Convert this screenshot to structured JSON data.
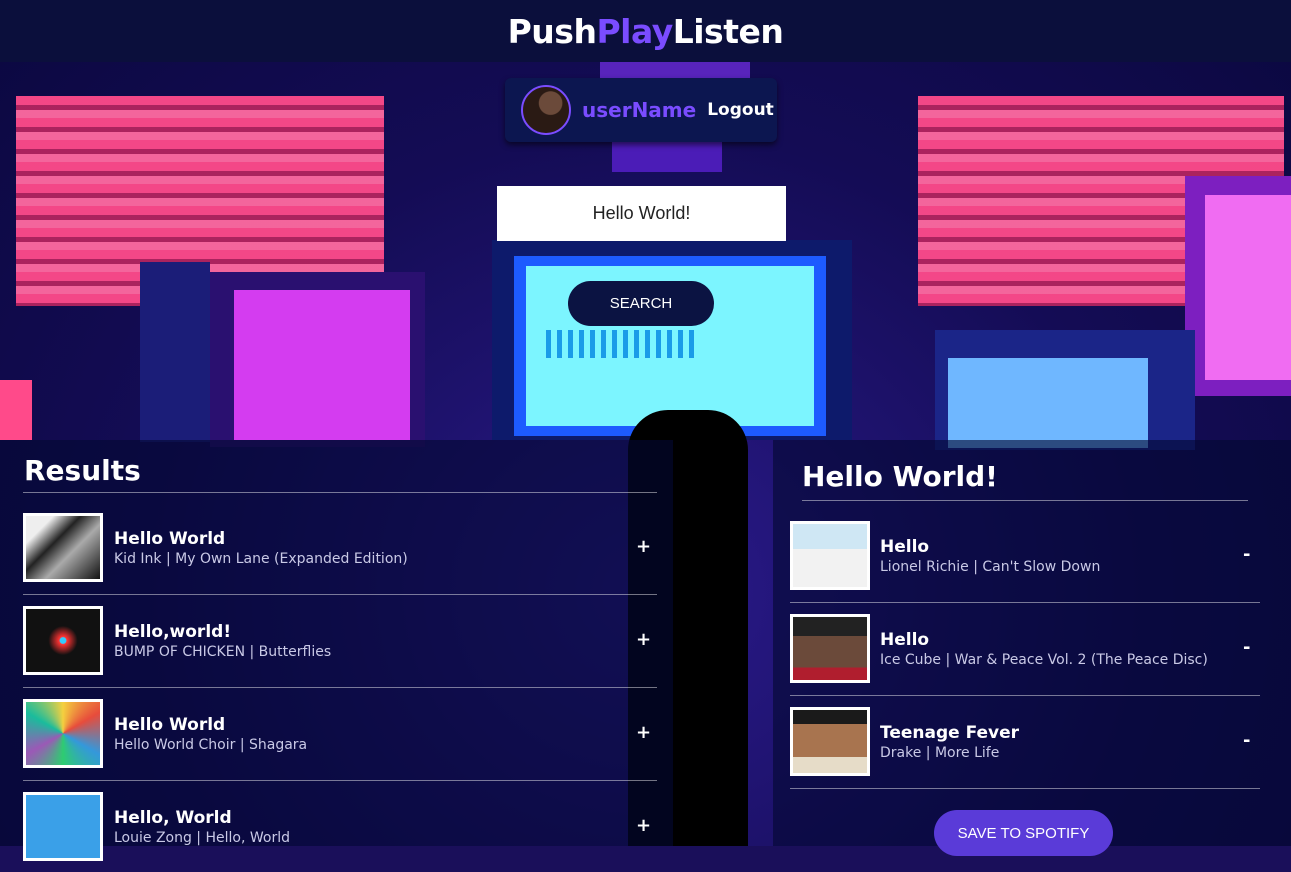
{
  "header": {
    "logo_part1": "Push",
    "logo_part2": "Play",
    "logo_part3": "Listen",
    "accent_color": "#7a4cff"
  },
  "user": {
    "name": "userName",
    "logout_label": "Logout",
    "avatar": "user-avatar-image"
  },
  "search": {
    "value": "Hello World!",
    "button_label": "SEARCH"
  },
  "results": {
    "title": "Results",
    "add_symbol": "+",
    "tracks": [
      {
        "name": "Hello World",
        "meta": "Kid Ink | My Own Lane (Expanded Edition)",
        "art": "album-cover-my-own-lane"
      },
      {
        "name": "Hello,world!",
        "meta": "BUMP OF CHICKEN | Butterflies",
        "art": "album-cover-butterflies"
      },
      {
        "name": "Hello World",
        "meta": "Hello World Choir | Shagara",
        "art": "album-cover-shagara"
      },
      {
        "name": "Hello, World",
        "meta": "Louie Zong | Hello, World",
        "art": "album-cover-hello-world"
      }
    ]
  },
  "playlist": {
    "name": "Hello World!",
    "remove_symbol": "-",
    "tracks": [
      {
        "name": "Hello",
        "meta": "Lionel Richie | Can't Slow Down",
        "art": "album-cover-cant-slow-down"
      },
      {
        "name": "Hello",
        "meta": "Ice Cube | War & Peace Vol. 2 (The Peace Disc)",
        "art": "album-cover-war-and-peace"
      },
      {
        "name": "Teenage Fever",
        "meta": "Drake | More Life",
        "art": "album-cover-more-life"
      }
    ],
    "save_label": "SAVE TO SPOTIFY"
  }
}
